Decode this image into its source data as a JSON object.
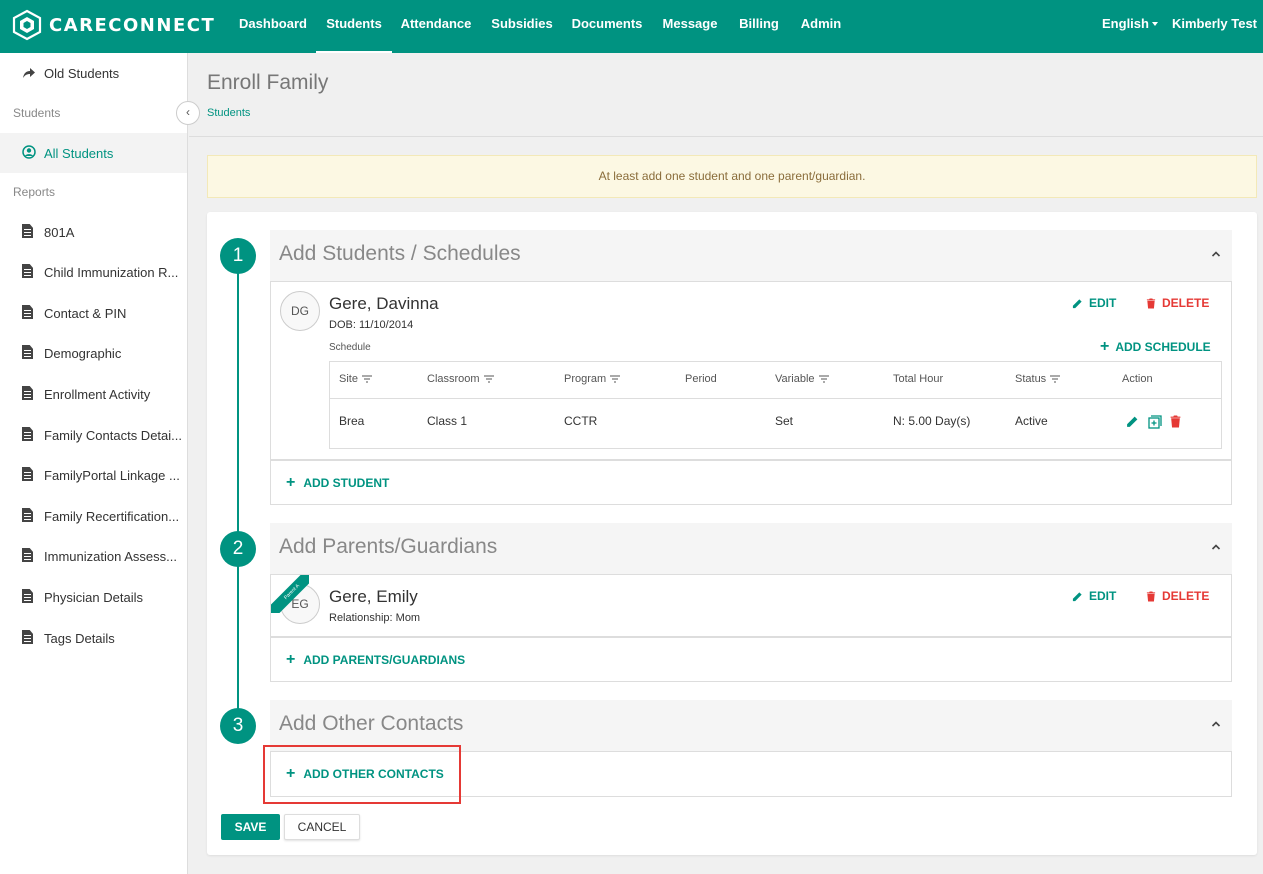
{
  "app": {
    "brand": "CARECONNECT"
  },
  "nav": {
    "items": [
      "Dashboard",
      "Students",
      "Attendance",
      "Subsidies",
      "Documents",
      "Message",
      "Billing",
      "Admin"
    ],
    "active": "Students",
    "language": "English",
    "user": "Kimberly Test"
  },
  "sidebar": {
    "old_students": "Old Students",
    "section_students": "Students",
    "all_students": "All Students",
    "section_reports": "Reports",
    "reports": [
      "801A",
      "Child Immunization R...",
      "Contact & PIN",
      "Demographic",
      "Enrollment Activity",
      "Family Contacts Detai...",
      "FamilyPortal Linkage ...",
      "Family Recertification...",
      "Immunization Assess...",
      "Physician Details",
      "Tags Details"
    ]
  },
  "page": {
    "title": "Enroll Family",
    "breadcrumb": "Students"
  },
  "alert": "At least add one student and one parent/guardian.",
  "steps": [
    {
      "number": "1",
      "title": "Add Students / Schedules"
    },
    {
      "number": "2",
      "title": "Add Parents/Guardians"
    },
    {
      "number": "3",
      "title": "Add Other Contacts"
    }
  ],
  "student": {
    "initials": "DG",
    "name": "Gere, Davinna",
    "dob": "DOB: 11/10/2014",
    "schedule_label": "Schedule",
    "edit": "EDIT",
    "delete": "DELETE",
    "add_schedule": "ADD SCHEDULE"
  },
  "schedule_table": {
    "columns": [
      "Site",
      "Classroom",
      "Program",
      "Period",
      "Variable",
      "Total Hour",
      "Status",
      "Action"
    ],
    "rows": [
      {
        "site": "Brea",
        "classroom": "Class 1",
        "program": "CCTR",
        "period": "",
        "variable": "Set",
        "total_hour": "N: 5.00 Day(s)",
        "status": "Active"
      }
    ]
  },
  "add_student": "ADD STUDENT",
  "parent": {
    "ribbon": "Parent A",
    "initials": "EG",
    "name": "Gere, Emily",
    "relationship": "Relationship: Mom",
    "edit": "EDIT",
    "delete": "DELETE"
  },
  "add_parents": "ADD PARENTS/GUARDIANS",
  "add_other_contacts": "ADD OTHER CONTACTS",
  "buttons": {
    "save": "SAVE",
    "cancel": "CANCEL"
  },
  "colors": {
    "primary": "#009381",
    "danger": "#e53935",
    "alert_bg": "#fcf8e3",
    "alert_text": "#8a6d3b"
  }
}
